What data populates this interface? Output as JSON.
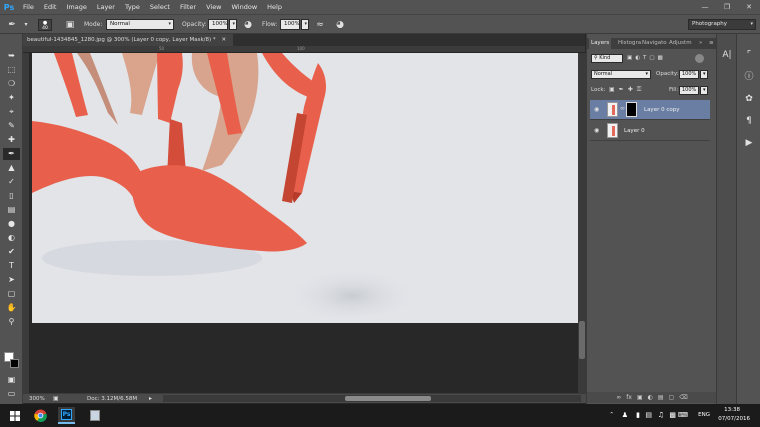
{
  "app": {
    "logo": "Ps"
  },
  "menu": [
    "File",
    "Edit",
    "Image",
    "Layer",
    "Type",
    "Select",
    "Filter",
    "View",
    "Window",
    "Help"
  ],
  "options": {
    "brush_size": "40",
    "mode_label": "Mode:",
    "mode_value": "Normal",
    "opacity_label": "Opacity:",
    "opacity_value": "100%",
    "flow_label": "Flow:",
    "flow_value": "100%",
    "workspace": "Photography"
  },
  "document": {
    "tab_title": "beautiful-1434845_1280.jpg @ 300% (Layer 0 copy, Layer Mask/8) *",
    "zoom": "300%",
    "doc_size": "Doc: 3.12M/6.58M"
  },
  "rulers": {
    "h": [
      "50",
      "100"
    ]
  },
  "layers_panel": {
    "tabs": [
      "Layers",
      "Histogra",
      "Navigato",
      "Adjustm"
    ],
    "filter_kind": "Kind",
    "blend_mode": "Normal",
    "opacity_label": "Opacity:",
    "opacity_value": "100%",
    "lock_label": "Lock:",
    "fill_label": "Fill:",
    "fill_value": "100%",
    "layers": [
      {
        "name": "Layer 0 copy",
        "selected": true,
        "has_mask": true
      },
      {
        "name": "Layer 0",
        "selected": false,
        "has_mask": false
      }
    ]
  },
  "taskbar": {
    "language": "ENG",
    "time": "13:38",
    "date": "07/07/2016"
  },
  "colors": {
    "accent": "#31a8ff",
    "shoe": "#e8604c",
    "selected_layer": "#6a7ea3"
  }
}
